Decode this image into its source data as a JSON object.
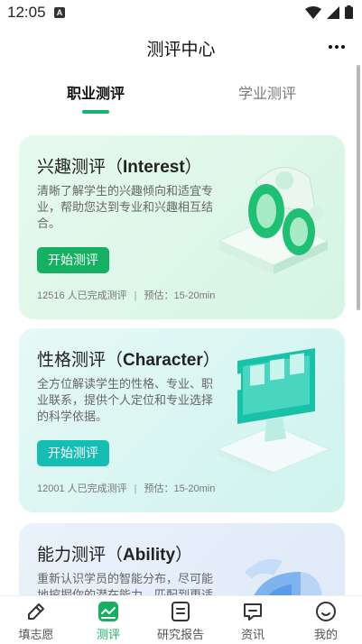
{
  "status_bar": {
    "time": "12:05",
    "badge": "A"
  },
  "header": {
    "title": "测评中心"
  },
  "tabs": [
    {
      "label": "职业测评",
      "active": true
    },
    {
      "label": "学业测评",
      "active": false
    }
  ],
  "cards": [
    {
      "title_cn": "兴趣测评（",
      "title_en": "Interest",
      "title_end": "）",
      "description": "清晰了解学生的兴趣倾向和适宜专业，帮助您达到专业和兴趣相互结合。",
      "button": "开始测评",
      "completed": "12516 人已完成测评",
      "separator": "|",
      "duration": "预估：15-20min",
      "accent": "#15b062"
    },
    {
      "title_cn": "性格测评（",
      "title_en": "Character",
      "title_end": "）",
      "description": "全方位解读学生的性格、专业、职业联系，提供个人定位和专业选择的科学依据。",
      "button": "开始测评",
      "completed": "12001 人已完成测评",
      "separator": "|",
      "duration": "预估：15-20min",
      "accent": "#16bdb2"
    },
    {
      "title_cn": "能力测评（",
      "title_en": "Ability",
      "title_end": "）",
      "description": "重新认识学员的智能分布，尽可能地挖掘你的潜在能力，匹配到更适"
    }
  ],
  "bottom_nav": [
    {
      "label": "填志愿",
      "icon": "pen-icon",
      "active": false
    },
    {
      "label": "测评",
      "icon": "chart-icon",
      "active": true
    },
    {
      "label": "研究报告",
      "icon": "report-icon",
      "active": false
    },
    {
      "label": "资讯",
      "icon": "message-icon",
      "active": false
    },
    {
      "label": "我的",
      "icon": "smile-icon",
      "active": false
    }
  ],
  "colors": {
    "primary": "#15b062",
    "teal": "#16bdb2"
  }
}
